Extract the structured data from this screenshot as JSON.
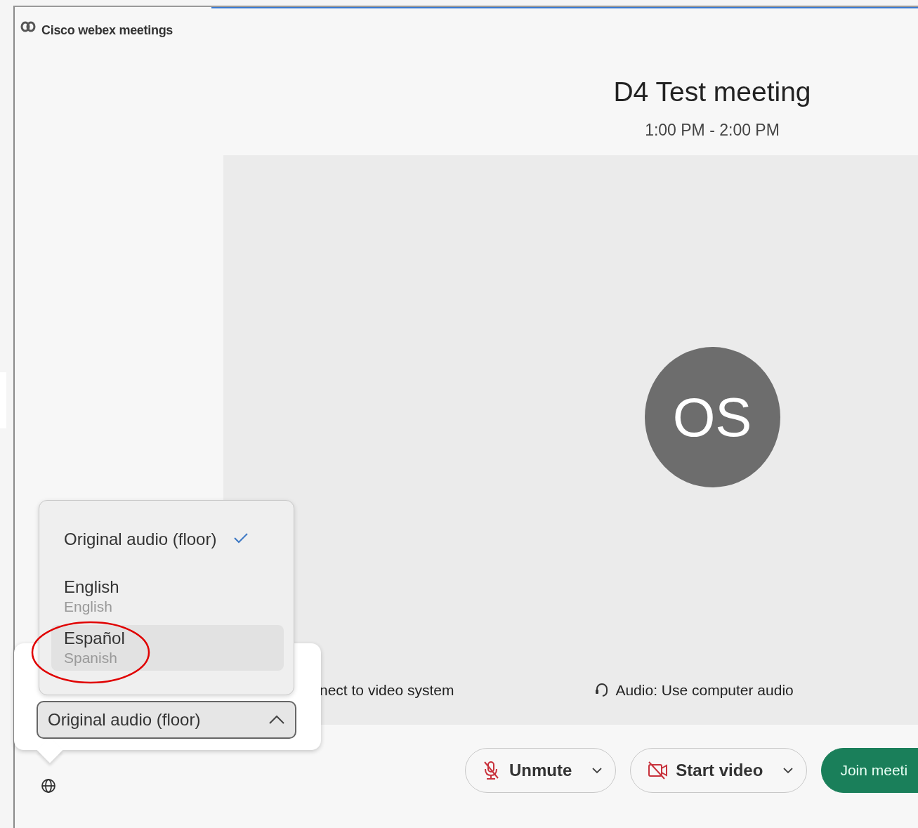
{
  "app": {
    "logo_text": "Cisco webex meetings"
  },
  "meeting": {
    "title": "D4 Test meeting",
    "time": "1:00 PM - 2:00 PM"
  },
  "preview": {
    "avatar_initials": "OS",
    "video_system_text": "nect to video system",
    "audio_text": "Audio: Use computer audio"
  },
  "controls": [
    {
      "kind": "mic",
      "label": "Unmute"
    },
    {
      "kind": "video",
      "label": "Start video"
    },
    {
      "kind": "join",
      "label": "Join meeti"
    }
  ],
  "language_popup": {
    "select_value": "Original audio (floor)",
    "expanded": true,
    "options": [
      {
        "label": "Original audio (floor)",
        "selected": true,
        "highlighted": false
      },
      {
        "label": "English",
        "sublabel": "English",
        "selected": false,
        "highlighted": false
      },
      {
        "label": "Español",
        "sublabel": "Spanish",
        "selected": false,
        "highlighted": true
      }
    ]
  },
  "annotations": [
    {
      "kind": "ellipse"
    }
  ]
}
